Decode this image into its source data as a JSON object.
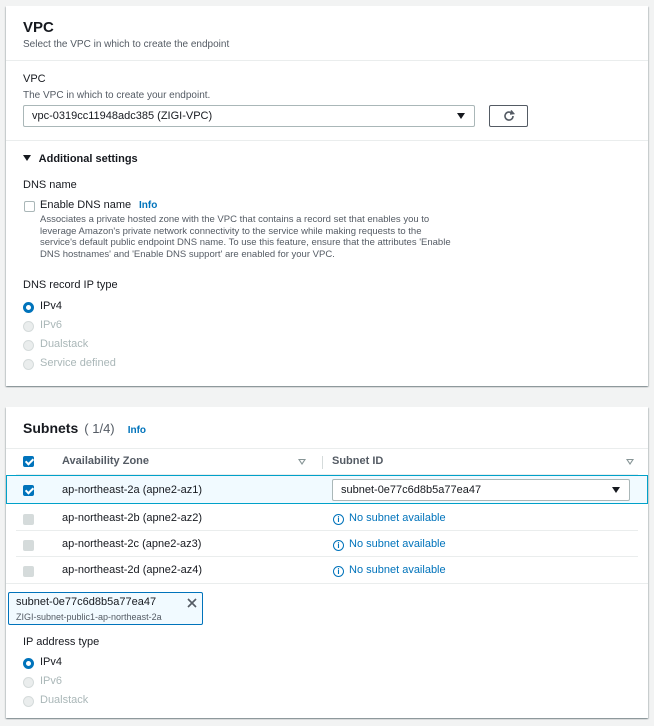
{
  "vpc_section": {
    "title": "VPC",
    "description": "Select the VPC in which to create the endpoint",
    "vpc_label": "VPC",
    "vpc_hint": "The VPC in which to create your endpoint.",
    "vpc_selected": "vpc-0319cc11948adc385 (ZIGI-VPC)",
    "refresh_icon": "refresh-icon",
    "additional_settings": "Additional settings",
    "dns_name_label": "DNS name",
    "enable_dns_label": "Enable DNS name",
    "enable_dns_checked": false,
    "info": "Info",
    "enable_dns_desc_lines": [
      "Associates a private hosted zone with the VPC that contains a record set that enables you to",
      "leverage Amazon's private network connectivity to the service while making requests to the",
      "service's default public endpoint DNS name. To use this feature, ensure that the attributes 'Enable",
      "DNS hostnames' and 'Enable DNS support' are enabled for your VPC."
    ],
    "dns_record_ip_type_label": "DNS record IP type",
    "dns_record_options": [
      {
        "label": "IPv4",
        "selected": true,
        "disabled": false
      },
      {
        "label": "IPv6",
        "selected": false,
        "disabled": true
      },
      {
        "label": "Dualstack",
        "selected": false,
        "disabled": true
      },
      {
        "label": "Service defined",
        "selected": false,
        "disabled": true
      }
    ]
  },
  "subnets_section": {
    "title": "Subnets",
    "count": "( 1/4)",
    "info": "Info",
    "columns": [
      "Availability Zone",
      "Subnet ID"
    ],
    "rows": [
      {
        "az": "ap-northeast-2a (apne2-az1)",
        "checked": true,
        "subnet": "subnet-0e77c6d8b5a77ea47",
        "available": true
      },
      {
        "az": "ap-northeast-2b (apne2-az2)",
        "checked": false,
        "subnet": "No subnet available",
        "available": false
      },
      {
        "az": "ap-northeast-2c (apne2-az3)",
        "checked": false,
        "subnet": "No subnet available",
        "available": false
      },
      {
        "az": "ap-northeast-2d (apne2-az4)",
        "checked": false,
        "subnet": "No subnet available",
        "available": false
      }
    ],
    "token": {
      "id": "subnet-0e77c6d8b5a77ea47",
      "name": "ZIGI-subnet-public1-ap-northeast-2a"
    },
    "ip_address_type_label": "IP address type",
    "ip_options": [
      {
        "label": "IPv4",
        "selected": true,
        "disabled": false
      },
      {
        "label": "IPv6",
        "selected": false,
        "disabled": true
      },
      {
        "label": "Dualstack",
        "selected": false,
        "disabled": true
      }
    ]
  },
  "colors": {
    "accent": "#0073bb",
    "disabled": "#aab7b8"
  }
}
